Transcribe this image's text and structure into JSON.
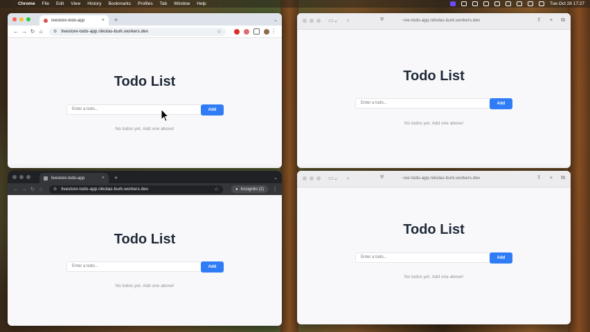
{
  "menubar": {
    "app": "Chrome",
    "items": [
      "File",
      "Edit",
      "View",
      "History",
      "Bookmarks",
      "Profiles",
      "Tab",
      "Window",
      "Help"
    ],
    "clock": "Tue Oct 28  17:27"
  },
  "windows": {
    "chrome": {
      "tab_title": "livestore-todo-app",
      "url": "livestore-todo-app.nikolas-burk.workers.dev"
    },
    "incognito": {
      "tab_title": "livestore-todo-app",
      "url": "livestore-todo-app.nikolas-burk.workers.dev",
      "incognito_label": "Incognito (2)"
    },
    "safari_top": {
      "url": "~ive-todo-app.nikolas-burk.workers.dev"
    },
    "safari_bottom": {
      "url": "~ive-todo-app.nikolas-burk.workers.dev"
    }
  },
  "app": {
    "title": "Todo List",
    "input_placeholder": "Enter a todo...",
    "add_label": "Add",
    "empty_text": "No todos yet. Add one above!"
  }
}
